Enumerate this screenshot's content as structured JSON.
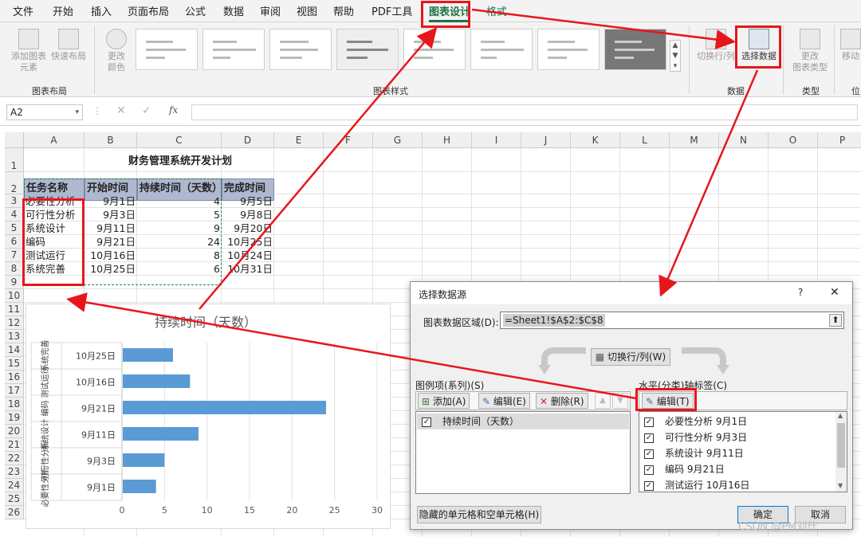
{
  "ribbon_tabs": [
    "文件",
    "开始",
    "插入",
    "页面布局",
    "公式",
    "数据",
    "审阅",
    "视图",
    "帮助",
    "PDF工具",
    "图表设计",
    "格式"
  ],
  "active_tab": "图表设计",
  "ribbon": {
    "add_element": "添加图表\n元素",
    "quick_layout": "快速布局",
    "change_color": "更改\n颜色",
    "group_layout": "图表布局",
    "group_styles": "图表样式",
    "switch_row_col": "切换行/列",
    "select_data": "选择数据",
    "group_data": "数据",
    "change_type": "更改\n图表类型",
    "group_type": "类型",
    "move_chart": "移动",
    "group_location": "位"
  },
  "formula_bar": {
    "name_box": "A2",
    "fx": "fx",
    "value": ""
  },
  "columns": [
    "A",
    "B",
    "C",
    "D",
    "E",
    "F",
    "G",
    "H",
    "I",
    "J",
    "K",
    "L",
    "M",
    "N",
    "O",
    "P"
  ],
  "rows": [
    "1",
    "2",
    "3",
    "4",
    "5",
    "6",
    "7",
    "8",
    "9",
    "10",
    "11",
    "12",
    "13",
    "14",
    "15",
    "16",
    "17",
    "18",
    "19",
    "20",
    "21",
    "22",
    "23",
    "24",
    "25",
    "26"
  ],
  "table": {
    "title": "财务管理系统开发计划",
    "headers": [
      "任务名称",
      "开始时间",
      "持续时间（天数）",
      "完成时间"
    ],
    "rows": [
      [
        "必要性分析",
        "9月1日",
        "4",
        "9月5日"
      ],
      [
        "可行性分析",
        "9月3日",
        "5",
        "9月8日"
      ],
      [
        "系统设计",
        "9月11日",
        "9",
        "9月20日"
      ],
      [
        "编码",
        "9月21日",
        "24",
        "10月25日"
      ],
      [
        "测试运行",
        "10月16日",
        "8",
        "10月24日"
      ],
      [
        "系统完善",
        "10月25日",
        "6",
        "10月31日"
      ]
    ]
  },
  "chart_data": {
    "type": "bar",
    "orientation": "horizontal",
    "title": "持续时间（天数）",
    "categories_outer": [
      "系统完善",
      "测试运行",
      "编码",
      "系统设计",
      "可行性分析",
      "必要性分析"
    ],
    "categories_inner": [
      "10月25日",
      "10月16日",
      "9月21日",
      "9月11日",
      "9月3日",
      "9月1日"
    ],
    "values": [
      6,
      8,
      24,
      9,
      5,
      4
    ],
    "xlim": [
      0,
      30
    ],
    "xticks": [
      "0",
      "5",
      "10",
      "15",
      "20",
      "25",
      "30"
    ],
    "grid": true,
    "bar_color": "#5b9bd5"
  },
  "dialog": {
    "title": "选择数据源",
    "help": "?",
    "close": "✕",
    "range_label": "图表数据区域(D):",
    "range_value": "=Sheet1!$A$2:$C$8",
    "switch_button": "切换行/列(W)",
    "legend_label": "图例项(系列)(S)",
    "add_button": "添加(A)",
    "edit_button": "编辑(E)",
    "delete_button": "删除(R)",
    "series": [
      "持续时间（天数）"
    ],
    "axis_label": "水平(分类)轴标签(C)",
    "axis_edit_button": "编辑(T)",
    "axis_items": [
      "必要性分析 9月1日",
      "可行性分析 9月3日",
      "系统设计 9月11日",
      "编码 9月21日",
      "测试运行 10月16日"
    ],
    "hidden_cells_button": "隐藏的单元格和空单元格(H)",
    "ok_button": "确定",
    "cancel_button": "取消"
  },
  "watermark": "CSDN @PM刘什",
  "colors": {
    "accent_green": "#1e7145",
    "header_fill": "#aeb9d0",
    "highlight_red": "#e8161b",
    "bar_blue": "#5b9bd5"
  }
}
